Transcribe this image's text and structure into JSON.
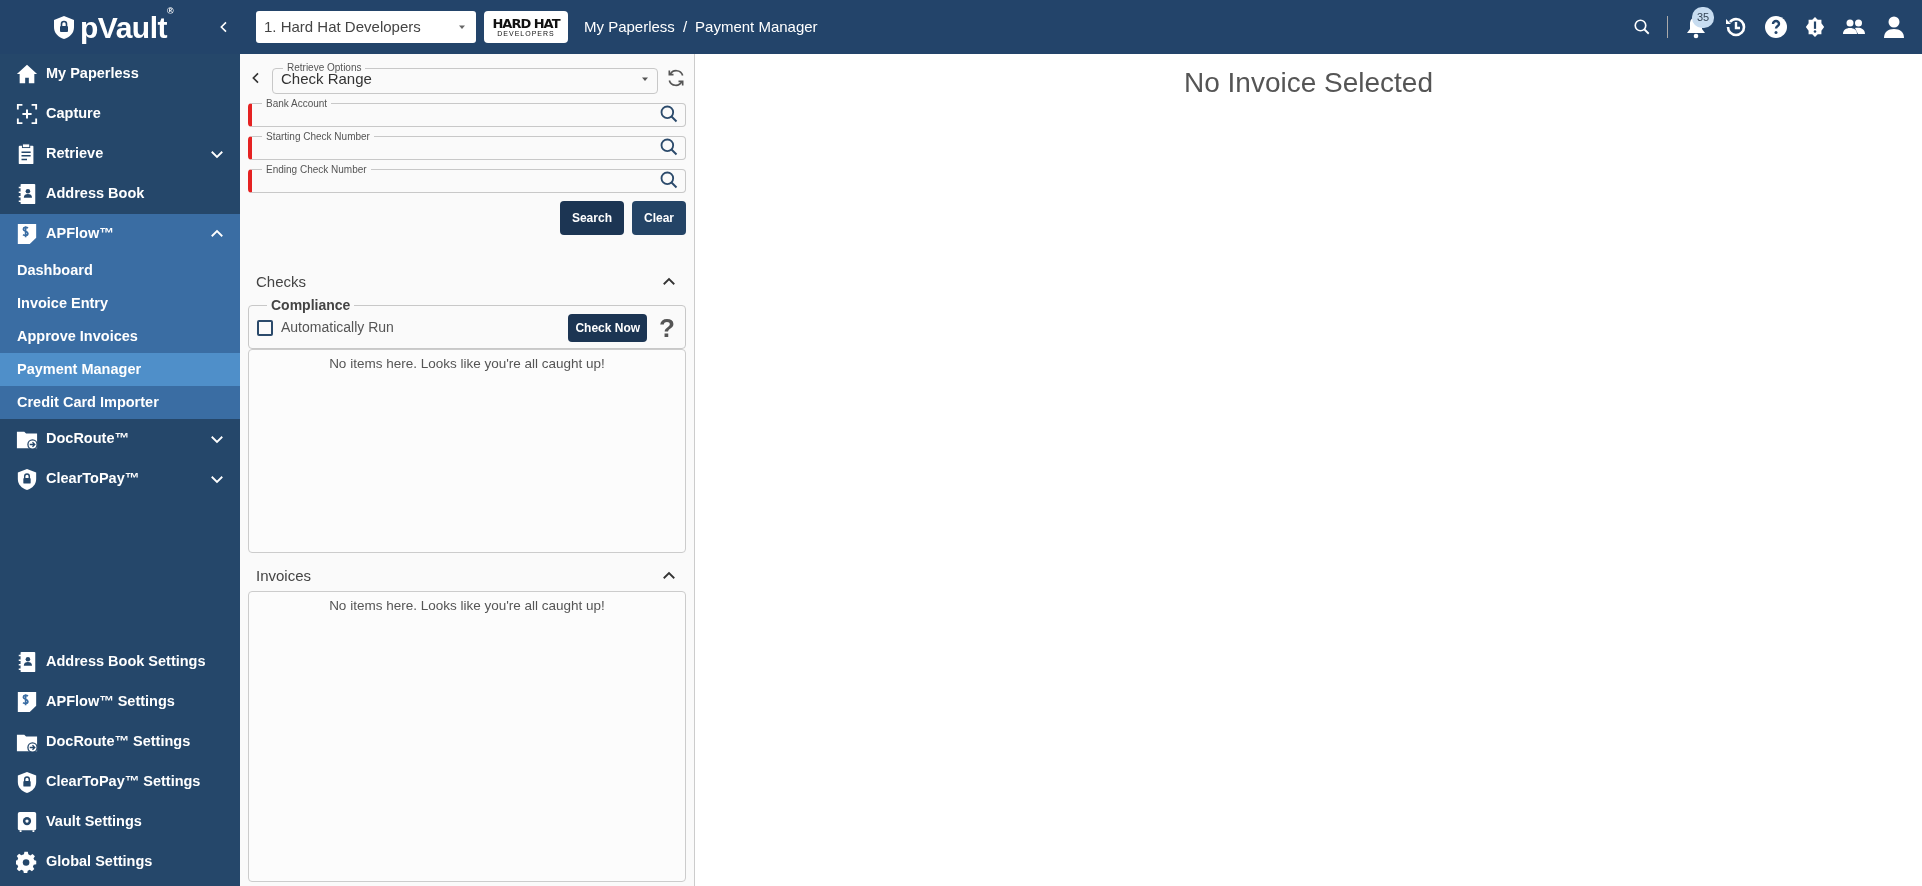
{
  "header": {
    "logo_text": "pVault",
    "logo_mark": "®",
    "company_select": {
      "value": "1. Hard Hat Developers"
    },
    "company_logo": {
      "text": "HARD HAT",
      "subtext": "DEVELOPERS"
    },
    "breadcrumb": [
      "My Paperless",
      "Payment Manager"
    ],
    "separator": "/",
    "notification_count": "35"
  },
  "sidebar": {
    "items": [
      {
        "label": "My Paperless"
      },
      {
        "label": "Capture"
      },
      {
        "label": "Retrieve",
        "expanded": false
      },
      {
        "label": "Address Book"
      },
      {
        "label": "APFlow™",
        "expanded": true,
        "children": [
          {
            "label": "Dashboard",
            "selected": false
          },
          {
            "label": "Invoice Entry",
            "selected": false
          },
          {
            "label": "Approve Invoices",
            "selected": false
          },
          {
            "label": "Payment Manager",
            "selected": true
          },
          {
            "label": "Credit Card Importer",
            "selected": false
          }
        ]
      },
      {
        "label": "DocRoute™",
        "expanded": false
      },
      {
        "label": "ClearToPay™",
        "expanded": false
      }
    ],
    "settings": [
      {
        "label": "Address Book Settings"
      },
      {
        "label": "APFlow™ Settings"
      },
      {
        "label": "DocRoute™ Settings"
      },
      {
        "label": "ClearToPay™ Settings"
      },
      {
        "label": "Vault Settings"
      },
      {
        "label": "Global Settings"
      }
    ]
  },
  "filter_panel": {
    "retrieve_options": {
      "label": "Retrieve Options",
      "value": "Check Range"
    },
    "fields": [
      {
        "label": "Bank Account",
        "required": true
      },
      {
        "label": "Starting Check Number",
        "required": true
      },
      {
        "label": "Ending Check Number",
        "required": true
      }
    ],
    "buttons": [
      "Search",
      "Clear"
    ],
    "checks": {
      "title": "Checks",
      "expanded": true,
      "compliance": {
        "title": "Compliance",
        "auto_run": {
          "label": "Automatically Run",
          "checked": false
        },
        "button": "Check Now",
        "help": "?"
      },
      "empty": "No items here. Looks like you're all caught up!"
    },
    "invoices": {
      "title": "Invoices",
      "expanded": true,
      "empty": "No items here. Looks like you're all caught up!"
    }
  },
  "main": {
    "message": "No Invoice Selected"
  }
}
